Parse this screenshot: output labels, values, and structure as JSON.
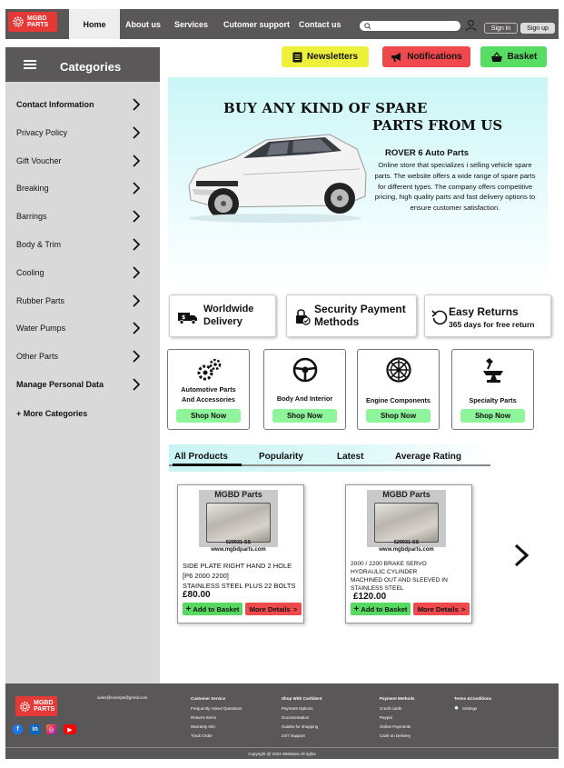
{
  "header": {
    "logo_text_1": "MGBD",
    "logo_text_2": "PARTS",
    "nav": [
      "Home",
      "About us",
      "Services",
      "Cutomer support",
      "Contact us"
    ],
    "search_placeholder": "",
    "signin_label": "Sign in",
    "signup_label": "Sign up"
  },
  "sidebar": {
    "title": "Categories",
    "items": [
      {
        "label": "Contact Information",
        "bold": true
      },
      {
        "label": "Privacy Policy",
        "bold": false
      },
      {
        "label": "Gift Voucher",
        "bold": false
      },
      {
        "label": "Breaking",
        "bold": false
      },
      {
        "label": "Barrings",
        "bold": false
      },
      {
        "label": "Body & Trim",
        "bold": false
      },
      {
        "label": "Cooling",
        "bold": false
      },
      {
        "label": "Rubber Parts",
        "bold": false
      },
      {
        "label": "Water Pumps",
        "bold": false
      },
      {
        "label": "Other Parts",
        "bold": false
      },
      {
        "label": "Manage Personal Data",
        "bold": true
      }
    ],
    "more_label": "+ More Categories"
  },
  "actions": {
    "newsletters": "Newsletters",
    "notifications": "Notifications",
    "basket": "Basket"
  },
  "hero": {
    "headline_1": "BUY ANY KIND OF SPARE",
    "headline_2": "PARTS FROM US",
    "subtitle": "ROVER 6 Auto Parts",
    "description": "Online store that specializes i selling vehicle spare parts. The website offers a wide range of spare parts for different types. The company offers competitive pricing, high quality parts and fast delivery options to ensure customer satisfaction."
  },
  "features": {
    "worldwide_1": "Worldwide",
    "worldwide_2": "Delivery",
    "security_1": "Security Payment",
    "security_2": "Methods",
    "returns_1": "Easy Returns",
    "returns_2": "365 days for free return"
  },
  "product_categories": [
    {
      "label_1": "Automotive Parts",
      "label_2": "And Accessories",
      "cta": "Shop Now"
    },
    {
      "label_1": "Body And Interior",
      "label_2": "",
      "cta": "Shop Now"
    },
    {
      "label_1": "Engine Components",
      "label_2": "",
      "cta": "Shop Now"
    },
    {
      "label_1": "Specialty Parts",
      "label_2": "",
      "cta": "Shop Now"
    }
  ],
  "tabs": [
    "All Products",
    "Popularity",
    "Latest",
    "Average Rating"
  ],
  "products": [
    {
      "image_brand": "MGBD Parts",
      "image_part_no": "529931-SS",
      "image_site": "www.mgbdparts.com",
      "title_lines": [
        "SIDE PLATE RIGHT HAND 2 HOLE",
        "[P6 2000 2200]",
        "STAINLESS STEEL PLUS 22 BOLTS"
      ],
      "price": "£80.00",
      "add_label": "Add to Basket",
      "more_label": "More Details"
    },
    {
      "image_brand": "MGBD Parts",
      "image_part_no": "529931-SS",
      "image_site": "www.mgbdparts.com",
      "title_lines": [
        "2000 / 2200 BRAKE SERVO",
        "HYDRAULIC CYLINDER",
        "MACHINED OUT AND SLEEVED IN",
        "STAINLESS STEEL"
      ],
      "price": "£120.00",
      "add_label": "Add to Basket",
      "more_label": "More Details"
    }
  ],
  "footer": {
    "email": "sales@roverp6@gmail.com",
    "columns": [
      {
        "heading": "Customer Service",
        "links": [
          "Frequently Asked Questions",
          "Returns Items",
          "Warranty Info",
          "Track Order"
        ]
      },
      {
        "heading": "Shop With Confident",
        "links": [
          "Payment Options",
          "Documentation",
          "Guides for shopping",
          "24/7 Support"
        ]
      },
      {
        "heading": "Payment Methods",
        "links": [
          "Credit cards",
          "Paypal",
          "Online Payments",
          "Cash on Delivery"
        ]
      },
      {
        "heading": "Terms &Conditions",
        "links": [
          "Settings"
        ]
      }
    ],
    "copyright": "Copyright @ 2024 Websites.All rights"
  },
  "colors": {
    "header_bg": "#595757",
    "brand_red": "#e53935",
    "green": "#58dd64",
    "yellow": "#eef139",
    "red_button": "#f0494d",
    "sidebar_bg": "#d9d9d9",
    "hero_bg": "#c9f6f6"
  }
}
